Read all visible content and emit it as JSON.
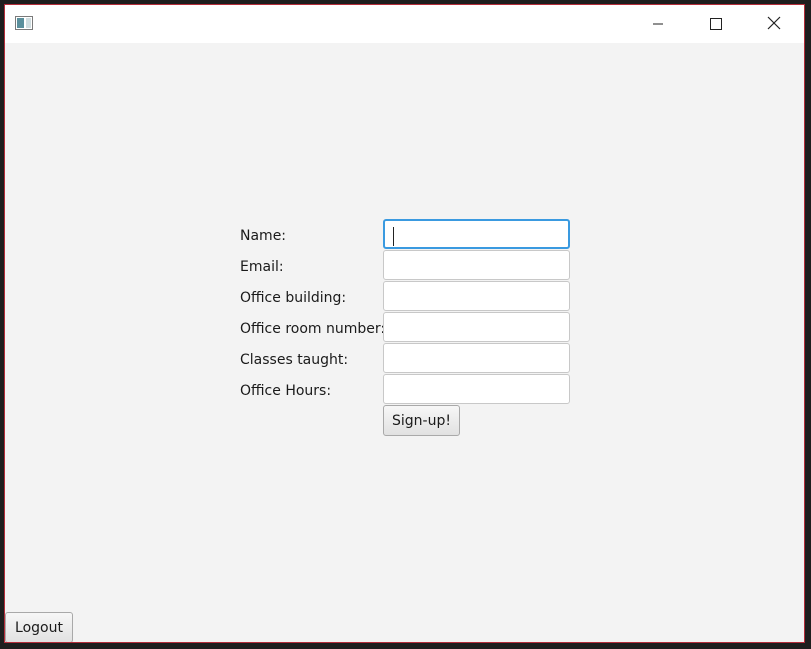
{
  "window": {
    "title": "",
    "controls": {
      "minimize": "minimize-icon",
      "maximize": "maximize-icon",
      "close": "close-icon"
    }
  },
  "form": {
    "name_label": "Name:",
    "email_label": "Email:",
    "building_label": "Office building:",
    "room_label": "Office room number:",
    "classes_label": "Classes taught:",
    "hours_label": "Office Hours:",
    "name_value": "",
    "email_value": "",
    "building_value": "",
    "room_value": "",
    "classes_value": "",
    "hours_value": "",
    "signup_label": "Sign-up!"
  },
  "footer": {
    "logout_label": "Logout"
  },
  "colors": {
    "focus_border": "#3a9ae0",
    "window_border": "#b32d3a",
    "background": "#f3f3f3"
  }
}
